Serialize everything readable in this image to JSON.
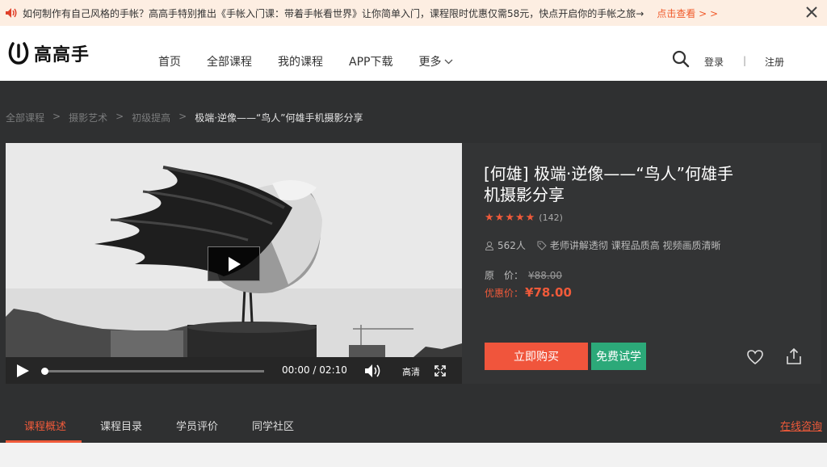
{
  "notice": {
    "message": "如何制作有自己风格的手帐？高高手特别推出《手帐入门课：带着手帐看世界》让你简单入门，课程限时优惠仅需58元，快点开启你的手帐之旅→",
    "link": "点击查看 > >",
    "icons": [
      "speaker-icon",
      "close-icon"
    ]
  },
  "header": {
    "logo_text": "高高手",
    "nav": [
      "首页",
      "全部课程",
      "我的课程",
      "APP下载",
      "更多"
    ],
    "login": "登录",
    "separator": "|",
    "register": "注册"
  },
  "breadcrumb": {
    "items": [
      "全部课程",
      "摄影艺术",
      "初级提高"
    ],
    "separator": ">",
    "current": "极端·逆像——“鸟人”何雄手机摄影分享"
  },
  "player": {
    "time_current": "00:00",
    "time_separator": "/",
    "time_total": "02:10",
    "quality": "高清",
    "progress": 0
  },
  "course": {
    "title": "[何雄] 极端·逆像——“鸟人”何雄手机摄影分享",
    "rating": 5,
    "rating_count": "(142)",
    "students": "562人",
    "tags": "老师讲解透彻 课程品质高 视频画质清晰",
    "original_label": "原　价：",
    "original_price": "¥88.00",
    "sale_label": "优惠价：",
    "sale_price": "¥78.00",
    "buy_button": "立即购买",
    "trial_button": "免费试学"
  },
  "tabs": {
    "items": [
      "课程概述",
      "课程目录",
      "学员评价",
      "同学社区"
    ],
    "active": 0,
    "consult": "在线咨询"
  },
  "colors": {
    "accent": "#f05a3a",
    "trial": "#2ca979",
    "dark_bg": "#2f3031"
  }
}
